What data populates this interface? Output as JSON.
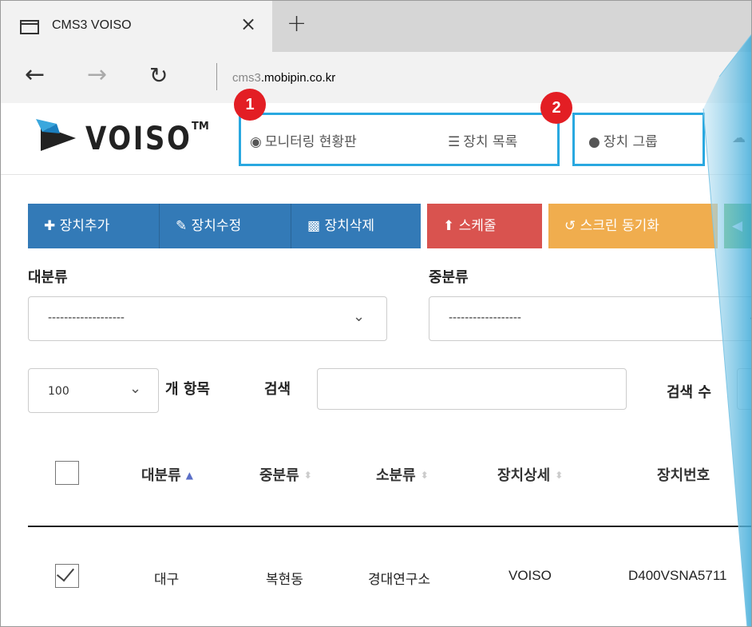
{
  "browser": {
    "tab_title": "CMS3 VOISO",
    "tab_close": "×",
    "tab_new": "+",
    "url_dim": "cms3",
    "url_main": ".mobipin.co.kr"
  },
  "app": {
    "logo_text": "VOISO",
    "logo_tm": "TM",
    "nav": {
      "monitoring": "모니터링 현황판",
      "device_list": "장치 목록",
      "device_group": "장치 그룹"
    },
    "badges": [
      "1",
      "2"
    ]
  },
  "toolbar": {
    "add": "장치추가",
    "edit": "장치수정",
    "delete": "장치삭제",
    "schedule": "스케줄",
    "screen_sync": "스크린 동기화"
  },
  "filters": {
    "major_label": "대분류",
    "major_value": "-------------------",
    "middle_label": "중분류",
    "middle_value": "------------------"
  },
  "list_controls": {
    "page_size": "100",
    "items_label": "개 항목",
    "search_label": "검색",
    "search_count_label": "검색 수"
  },
  "table": {
    "columns": [
      "대분류",
      "중분류",
      "소분류",
      "장치상세",
      "장치번호"
    ],
    "rows": [
      {
        "checked": true,
        "major": "대구",
        "middle": "복현동",
        "minor": "경대연구소",
        "detail": "VOISO",
        "serial": "D400VSNA5711"
      }
    ]
  },
  "colors": {
    "highlight": "#29a8e0",
    "badge": "#e31e24",
    "primary": "#337ab7",
    "danger": "#d9534f",
    "warning": "#f0ad4e",
    "success": "#5cb85c"
  }
}
